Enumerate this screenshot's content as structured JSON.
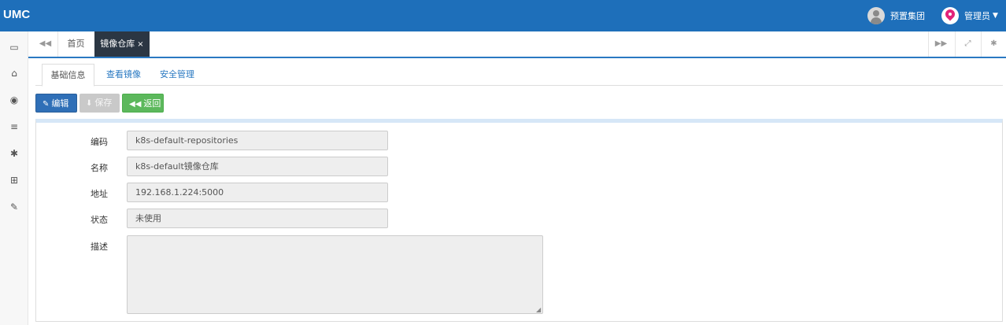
{
  "header": {
    "logo": "UMC",
    "org_name": "预置集团",
    "user_name": "管理员"
  },
  "sidebar": {
    "icons": [
      "id-card-icon",
      "bank-icon",
      "eye-icon",
      "list-icon",
      "gear-icon",
      "sitemap-icon",
      "wrench-icon"
    ]
  },
  "tabs": {
    "home": "首页",
    "active": "镜像仓库",
    "close_glyph": "×"
  },
  "subtabs": [
    "基础信息",
    "查看镜像",
    "安全管理"
  ],
  "toolbar": {
    "edit": "编辑",
    "save": "保存",
    "back": "返回"
  },
  "form": {
    "code_label": "编码",
    "code_value": "k8s-default-repositories",
    "name_label": "名称",
    "name_value": "k8s-default镜像仓库",
    "address_label": "地址",
    "address_value": "192.168.1.224:5000",
    "status_label": "状态",
    "status_value": "未使用",
    "desc_label": "描述",
    "desc_value": ""
  },
  "colors": {
    "header_bg": "#1e6fba",
    "active_tab_bg": "#2b3643",
    "edit_button": "#2f6fb7",
    "back_button": "#5cb85c"
  }
}
